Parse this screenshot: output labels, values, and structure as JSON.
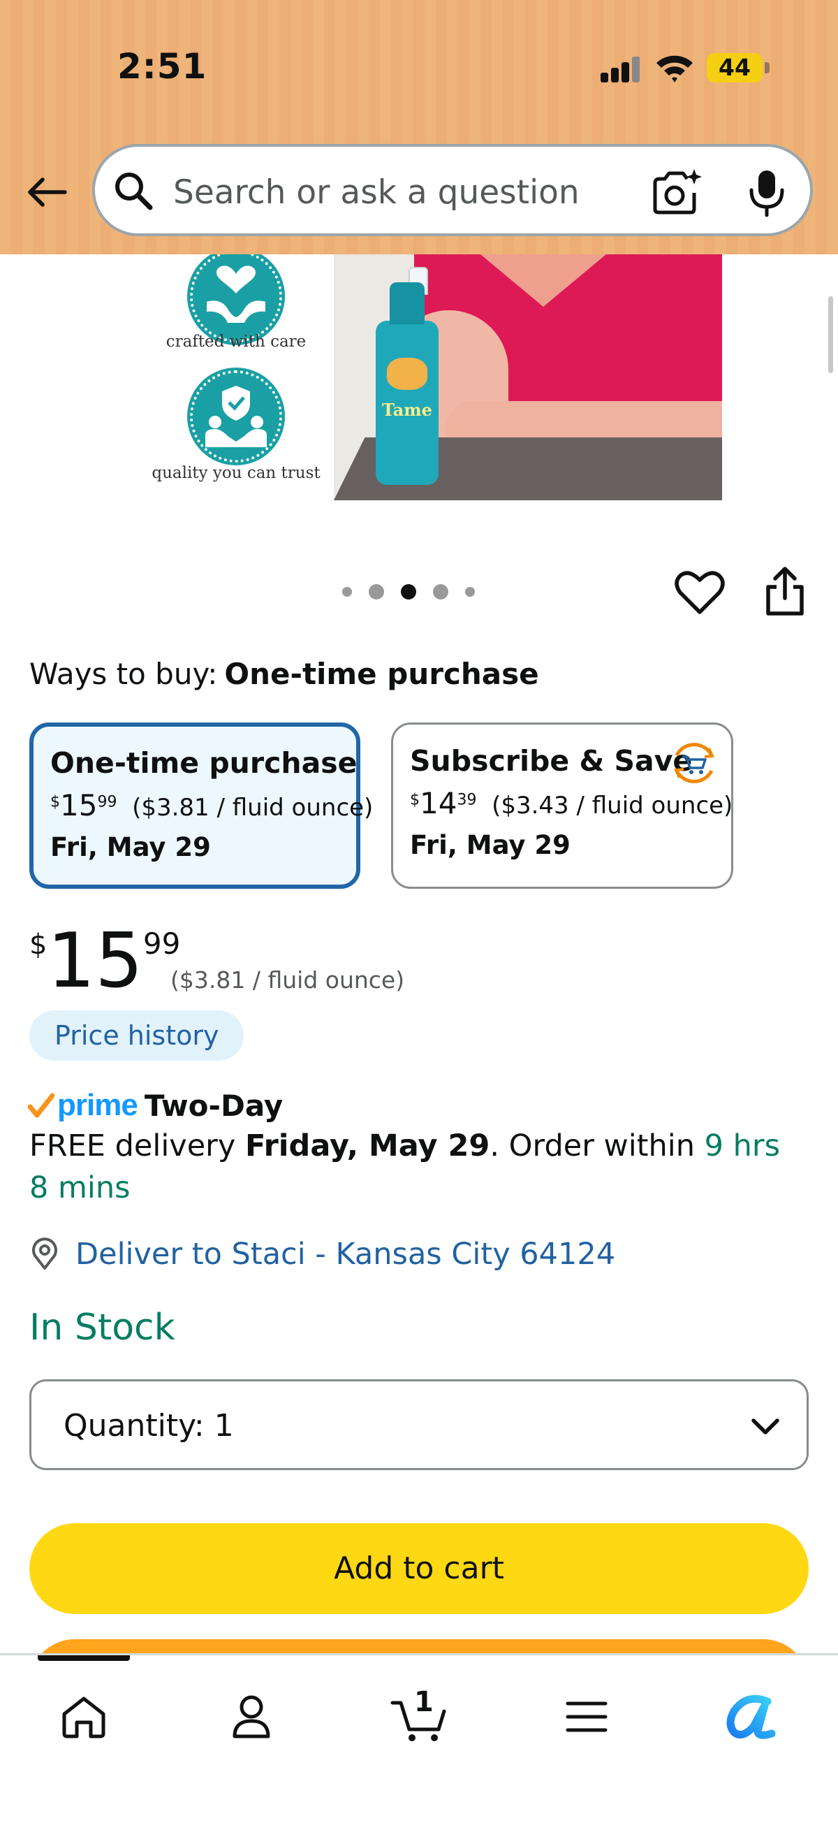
{
  "status_bar": {
    "time": "2:51",
    "battery": "44"
  },
  "search": {
    "placeholder": "Search or ask a question"
  },
  "product_image": {
    "badges": [
      "crafted with care",
      "quality you can trust"
    ],
    "bottle_label": "Tame",
    "carousel": {
      "count": 5,
      "active_index": 2
    }
  },
  "ways_to_buy": {
    "label": "Ways to buy:",
    "selected": "One-time purchase",
    "options": [
      {
        "title": "One-time purchase",
        "price_currency": "$",
        "price_whole": "15",
        "price_fraction": "99",
        "unit_price": "($3.81 / fluid ounce)",
        "date": "Fri, May 29",
        "selected": true
      },
      {
        "title": "Subscribe & Save",
        "price_currency": "$",
        "price_whole": "14",
        "price_fraction": "39",
        "unit_price": "($3.43 / fluid ounce)",
        "date": "Fri, May 29",
        "selected": false
      }
    ]
  },
  "price": {
    "currency": "$",
    "whole": "15",
    "fraction": "99",
    "unit_price": "($3.81 / fluid ounce)"
  },
  "price_history_label": "Price history",
  "delivery": {
    "prime_word": "prime",
    "prime_speed": "Two-Day",
    "line_prefix": "FREE delivery ",
    "date": "Friday, May 29",
    "line_middle": ". Order within ",
    "countdown": "9 hrs 8 mins",
    "deliver_to": "Deliver to Staci - Kansas City 64124"
  },
  "stock_status": "In Stock",
  "quantity": {
    "label": "Quantity:",
    "value": "1"
  },
  "add_to_cart_label": "Add to cart",
  "bottom_nav": {
    "cart_count": "1",
    "items": [
      "home",
      "account",
      "cart",
      "menu",
      "rufus"
    ]
  },
  "colors": {
    "header_bg": "#efb47a",
    "accent_blue": "#2166a6",
    "link_blue": "#2162a1",
    "green": "#067d62",
    "cart_yellow": "#ffd814",
    "buy_orange": "#ffa41c",
    "prime_blue": "#1399ff"
  }
}
